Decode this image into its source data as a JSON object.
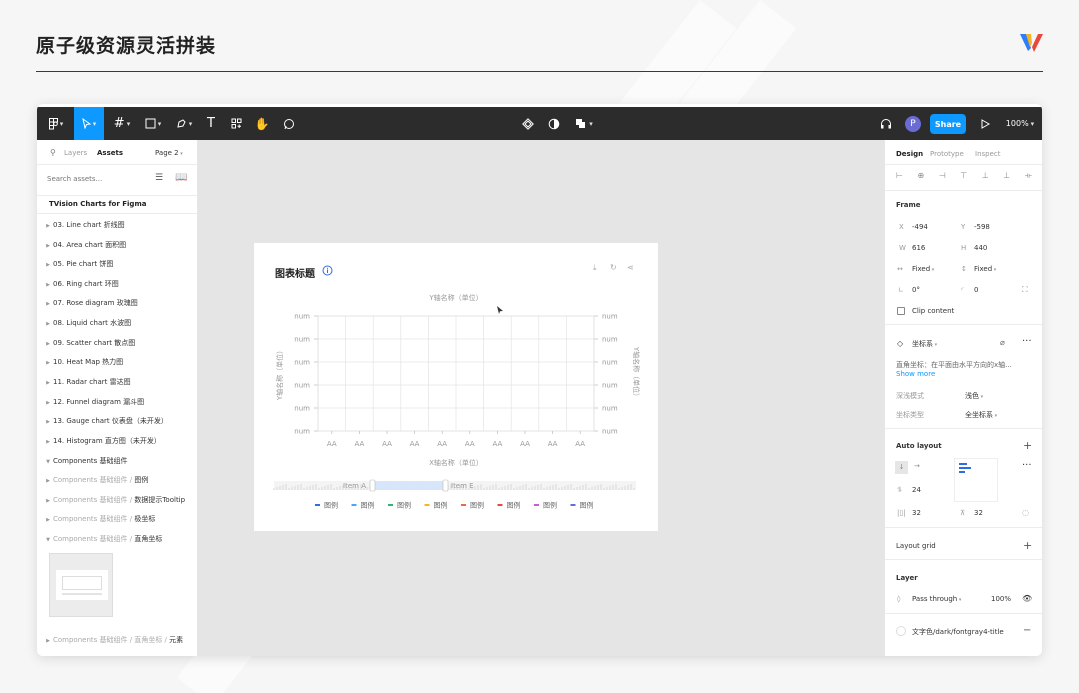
{
  "slide": {
    "title": "原子级资源灵活拼装"
  },
  "toolbar": {
    "zoom": "100%",
    "share_label": "Share",
    "avatar_letter": "P"
  },
  "left_panel": {
    "tab_layers": "Layers",
    "tab_assets": "Assets",
    "page": "Page 2",
    "search_placeholder": "Search assets...",
    "library_title": "TVision Charts for Figma",
    "items": [
      "03. Line chart 折线图",
      "04. Area chart 面积图",
      "05. Pie chart 饼图",
      "06. Ring chart 环图",
      "07. Rose diagram 玫瑰图",
      "08. Liquid chart 水波图",
      "09. Scatter chart 散点图",
      "10. Heat Map 热力图",
      "11. Radar chart 雷达图",
      "12. Funnel diagram 漏斗图",
      "13. Gauge chart 仪表盘（未开发）",
      "14. Histogram 直方图（未开发）"
    ],
    "components_group": "Components 基础组件",
    "component_prefix": "Components 基础组件 /",
    "sub_items": [
      "图例",
      "数据提示Tooltip",
      "极坐标",
      "直角坐标"
    ],
    "last_prefix": "Components 基础组件 / 直角坐标 /",
    "last_item": "元素"
  },
  "chart_card": {
    "title": "图表标题",
    "chart_data": {
      "type": "line",
      "top_label": "Y轴名称（单位）",
      "ylabel_left": "Y轴名称（单位）",
      "ylabel_right": "Y轴名称（单位）",
      "xlabel": "X轴名称（单位）",
      "y_ticks": [
        "num",
        "num",
        "num",
        "num",
        "num",
        "num"
      ],
      "categories": [
        "AA",
        "AA",
        "AA",
        "AA",
        "AA",
        "AA",
        "AA",
        "AA",
        "AA",
        "AA"
      ],
      "slider_labels": [
        "Item A",
        "Item E"
      ],
      "legend": [
        {
          "label": "图例",
          "color": "#2e6be6"
        },
        {
          "label": "图例",
          "color": "#4fa3f7"
        },
        {
          "label": "图例",
          "color": "#2bb673"
        },
        {
          "label": "图例",
          "color": "#f5b428"
        },
        {
          "label": "图例",
          "color": "#ee6a3c"
        },
        {
          "label": "图例",
          "color": "#e8483e"
        },
        {
          "label": "图例",
          "color": "#c060d8"
        },
        {
          "label": "图例",
          "color": "#6b6bd6"
        }
      ]
    }
  },
  "right_panel": {
    "tabs": [
      "Design",
      "Prototype",
      "Inspect"
    ],
    "frame_label": "Frame",
    "x_label": "X",
    "x_value": "-494",
    "y_label": "Y",
    "y_value": "-598",
    "w_label": "W",
    "w_value": "616",
    "h_label": "H",
    "h_value": "440",
    "width_mode": "Fixed",
    "height_mode": "Fixed",
    "rotation": "0°",
    "radius": "0",
    "clip_content": "Clip content",
    "component_name": "坐标系",
    "description": "直角坐标：在平面由水平方向的x轴...",
    "show_more": "Show more",
    "prop1_label": "深浅模式",
    "prop1_value": "浅色",
    "prop2_label": "坐标类型",
    "prop2_value": "全坐标系",
    "auto_layout": "Auto layout",
    "spacing": "24",
    "padding_h": "32",
    "padding_v": "32",
    "layout_grid": "Layout grid",
    "layer_label": "Layer",
    "blend_mode": "Pass through",
    "opacity": "100%",
    "fill_style": "文字色/dark/fontgray4-title"
  }
}
